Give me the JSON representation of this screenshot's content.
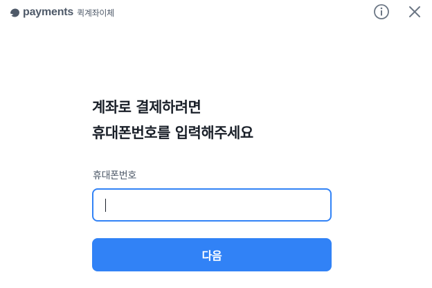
{
  "header": {
    "brand_name": "payments",
    "brand_sub": "퀵계좌이체",
    "logo_icon": "toss-logo-icon",
    "info_icon": "info-icon",
    "close_icon": "close-icon"
  },
  "main": {
    "title_line1": "계좌로 결제하려면",
    "title_line2": "휴대폰번호를 입력해주세요",
    "field_label": "휴대폰번호",
    "phone_value": "",
    "next_label": "다음"
  },
  "colors": {
    "accent": "#3182f6",
    "text": "#191f28",
    "muted": "#4e5968"
  }
}
